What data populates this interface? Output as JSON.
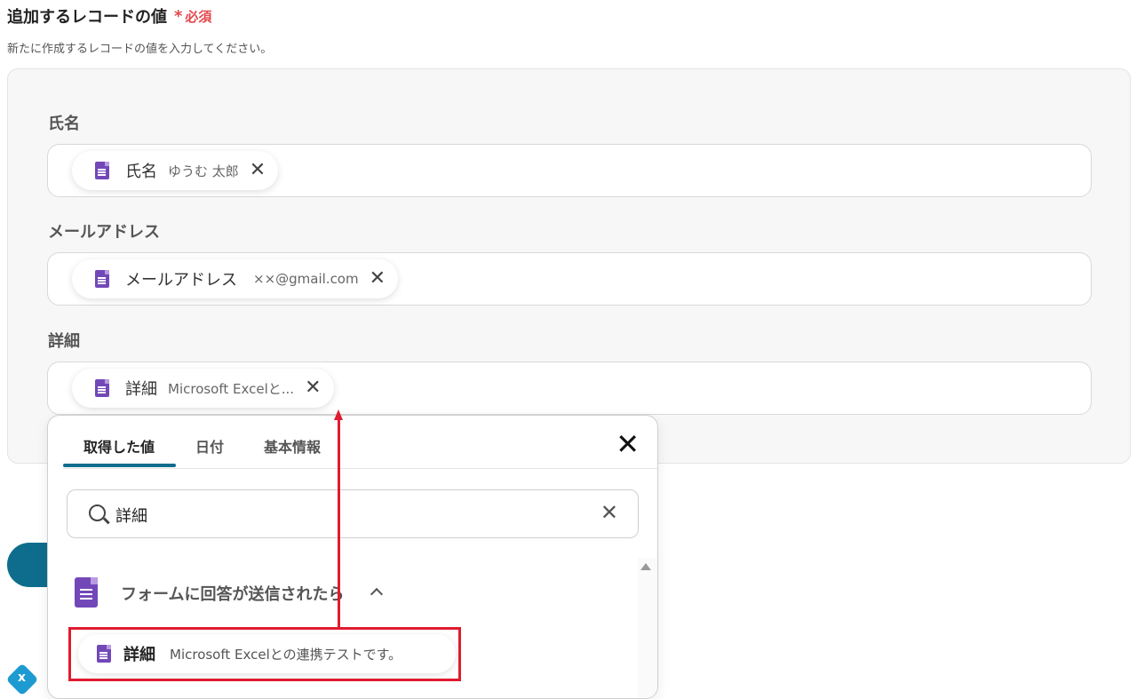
{
  "section": {
    "title": "追加するレコードの値",
    "required_mark": "*",
    "required_label": "必須",
    "description": "新たに作成するレコードの値を入力してください。"
  },
  "fields": [
    {
      "label": "氏名",
      "chip": {
        "name": "氏名",
        "value": "ゆうむ 太郎"
      }
    },
    {
      "label": "メールアドレス",
      "chip": {
        "name": "メールアドレス",
        "value": "××@gmail.com"
      }
    },
    {
      "label": "詳細",
      "chip": {
        "name": "詳細",
        "value": "Microsoft Excelと..."
      }
    }
  ],
  "popup": {
    "tabs": [
      "取得した値",
      "日付",
      "基本情報"
    ],
    "active_tab": "取得した値",
    "search": {
      "value": "詳細"
    },
    "group": {
      "title": "フォームに回答が送信されたら"
    },
    "result": {
      "name": "詳細",
      "value": "Microsoft Excelとの連携テストです。"
    }
  },
  "icons": {
    "chip_remove": "close-icon",
    "form_icon": "google-forms-icon",
    "search": "search-icon",
    "popup_close": "close-icon",
    "group_toggle": "chevron-up-icon"
  },
  "colors": {
    "required": "#e5484d",
    "accent": "#0e6d8c",
    "form_purple": "#7248b9",
    "annotation_red": "#e01b2f"
  }
}
